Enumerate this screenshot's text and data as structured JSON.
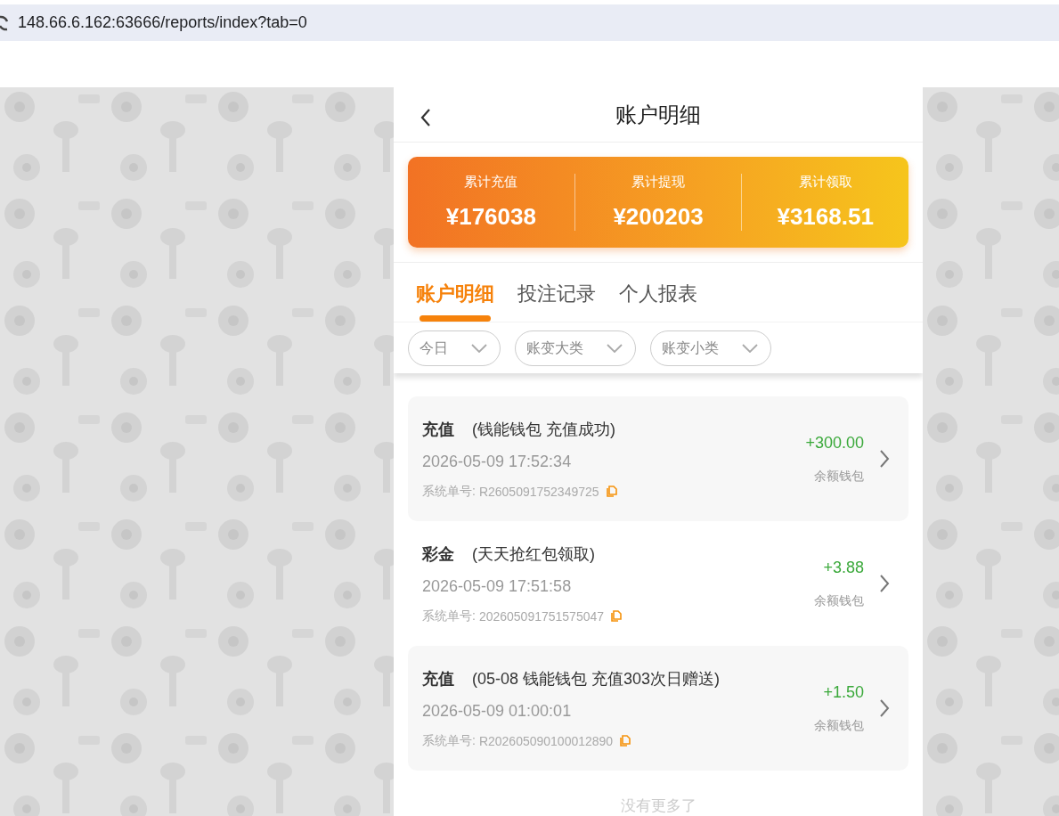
{
  "address_bar": {
    "url": "148.66.6.162:63666/reports/index?tab=0"
  },
  "header": {
    "title": "账户明细"
  },
  "summary": [
    {
      "label": "累计充值",
      "value": "¥176038"
    },
    {
      "label": "累计提现",
      "value": "¥200203"
    },
    {
      "label": "累计领取",
      "value": "¥3168.51"
    }
  ],
  "tabs": [
    {
      "label": "账户明细",
      "selected": true
    },
    {
      "label": "投注记录",
      "selected": false
    },
    {
      "label": "个人报表",
      "selected": false
    }
  ],
  "filters": [
    {
      "label": "今日"
    },
    {
      "label": "账变大类"
    },
    {
      "label": "账变小类"
    }
  ],
  "records": [
    {
      "type": "充值",
      "note": "(钱能钱包 充值成功)",
      "time": "2026-05-09 17:52:34",
      "order_label": "系统单号:",
      "order_no": "R2605091752349725",
      "amount": "+300.00",
      "wallet": "余额钱包"
    },
    {
      "type": "彩金",
      "note": "(天天抢红包领取)",
      "time": "2026-05-09 17:51:58",
      "order_label": "系统单号:",
      "order_no": "202605091751575047",
      "amount": "+3.88",
      "wallet": "余额钱包"
    },
    {
      "type": "充值",
      "note": "(05-08 钱能钱包 充值303次日赠送)",
      "time": "2026-05-09 01:00:01",
      "order_label": "系统单号:",
      "order_no": "R202605090100012890",
      "amount": "+1.50",
      "wallet": "余额钱包"
    }
  ],
  "footer": {
    "text": "没有更多了"
  }
}
